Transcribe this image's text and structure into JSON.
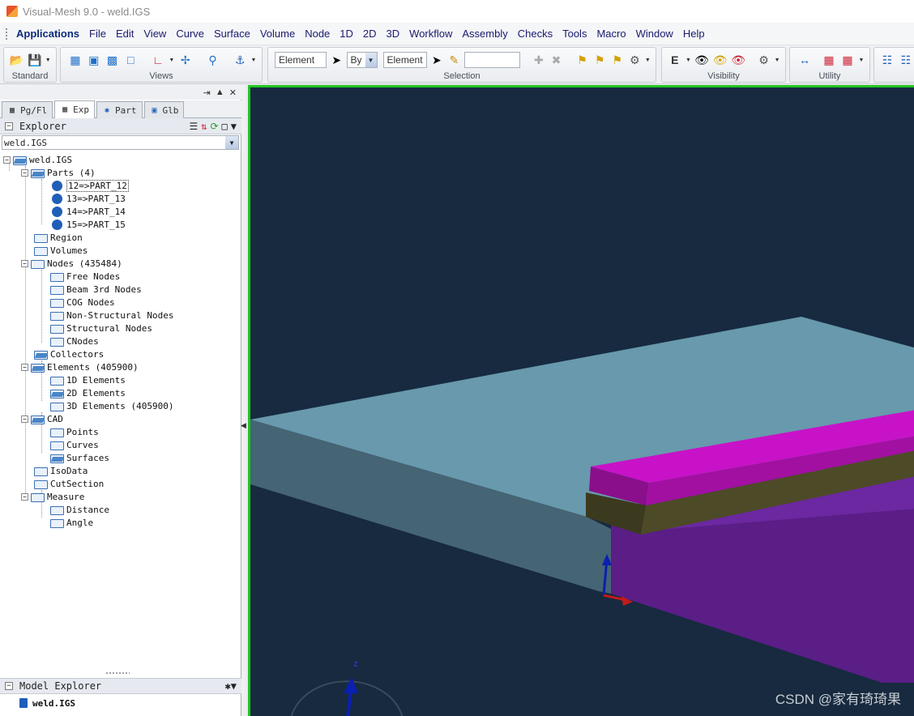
{
  "window": {
    "title": "Visual-Mesh 9.0 - weld.IGS"
  },
  "menu": [
    "Applications",
    "File",
    "Edit",
    "View",
    "Curve",
    "Surface",
    "Volume",
    "Node",
    "1D",
    "2D",
    "3D",
    "Workflow",
    "Assembly",
    "Checks",
    "Tools",
    "Macro",
    "Window",
    "Help"
  ],
  "toolbar": {
    "groups": {
      "standard": "Standard",
      "views": "Views",
      "selection": "Selection",
      "visibility": "Visibility",
      "utility": "Utility"
    },
    "selection_type": "Element",
    "selection_by": "By",
    "selection_by_value": "Element",
    "selection_search": ""
  },
  "left_panel": {
    "tabs": [
      "Pg/Fl",
      "Exp",
      "Part",
      "Glb"
    ],
    "explorer_title": "Explorer",
    "model_selected": "weld.IGS",
    "tree": {
      "root": "weld.IGS",
      "parts": "Parts (4)",
      "part_items": [
        "12=>PART_12",
        "13=>PART_13",
        "14=>PART_14",
        "15=>PART_15"
      ],
      "region": "Region",
      "volumes": "Volumes",
      "nodes": "Nodes (435484)",
      "node_items": [
        "Free Nodes",
        "Beam 3rd Nodes",
        "COG Nodes",
        "Non-Structural Nodes",
        "Structural Nodes",
        "CNodes"
      ],
      "collectors": "Collectors",
      "elements": "Elements (405900)",
      "element_items": [
        "1D Elements",
        "2D Elements",
        "3D Elements (405900)"
      ],
      "cad": "CAD",
      "cad_items": [
        "Points",
        "Curves",
        "Surfaces"
      ],
      "isodata": "IsoData",
      "cutsection": "CutSection",
      "measure": "Measure",
      "measure_items": [
        "Distance",
        "Angle"
      ]
    },
    "model_explorer_title": "Model Explorer",
    "model_explorer_item": "weld.IGS"
  },
  "viewport": {
    "border_color": "#22c422",
    "background": "#172a3f",
    "axis_label": "z",
    "watermark": "CSDN @家有琦琦果"
  }
}
